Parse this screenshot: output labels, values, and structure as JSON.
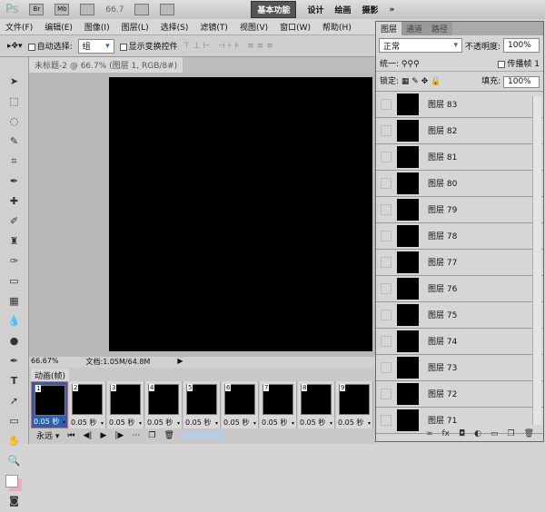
{
  "titlebar": {
    "logo": "Ps",
    "bridge": "Br",
    "mini": "Mb",
    "zoom": "66.7",
    "workspaces": [
      "基本功能",
      "设计",
      "绘画",
      "摄影"
    ],
    "more": "»"
  },
  "menu": [
    "文件(F)",
    "编辑(E)",
    "图像(I)",
    "图层(L)",
    "选择(S)",
    "滤镜(T)",
    "视图(V)",
    "窗口(W)",
    "帮助(H)"
  ],
  "options": {
    "auto_select": "自动选择:",
    "auto_select_value": "组",
    "show_transform": "显示变换控件"
  },
  "document": {
    "tab": "未标题-2 @ 66.7% (图层 1, RGB/8#)",
    "zoom": "66.67%",
    "doc_size": "文档:1.05M/64.8M"
  },
  "animation": {
    "tab": "动画(帧)",
    "loop": "永远",
    "frames": [
      {
        "n": "1",
        "d": "0.05 秒"
      },
      {
        "n": "2",
        "d": "0.05 秒"
      },
      {
        "n": "3",
        "d": "0.05 秒"
      },
      {
        "n": "4",
        "d": "0.05 秒"
      },
      {
        "n": "5",
        "d": "0.05 秒"
      },
      {
        "n": "6",
        "d": "0.05 秒"
      },
      {
        "n": "7",
        "d": "0.05 秒"
      },
      {
        "n": "8",
        "d": "0.05 秒"
      },
      {
        "n": "9",
        "d": "0.05 秒"
      }
    ]
  },
  "layers": {
    "tabs": [
      "图层",
      "通道",
      "路径"
    ],
    "blend": "正常",
    "opacity_label": "不透明度:",
    "opacity": "100%",
    "unify": "统一:",
    "propagate": "传播帧 1",
    "lock": "锁定:",
    "fill_label": "填充:",
    "fill": "100%",
    "items": [
      "图层 83",
      "图层 82",
      "图层 81",
      "图层 80",
      "图层 79",
      "图层 78",
      "图层 77",
      "图层 76",
      "图层 75",
      "图层 74",
      "图层 73",
      "图层 72",
      "图层 71"
    ]
  }
}
